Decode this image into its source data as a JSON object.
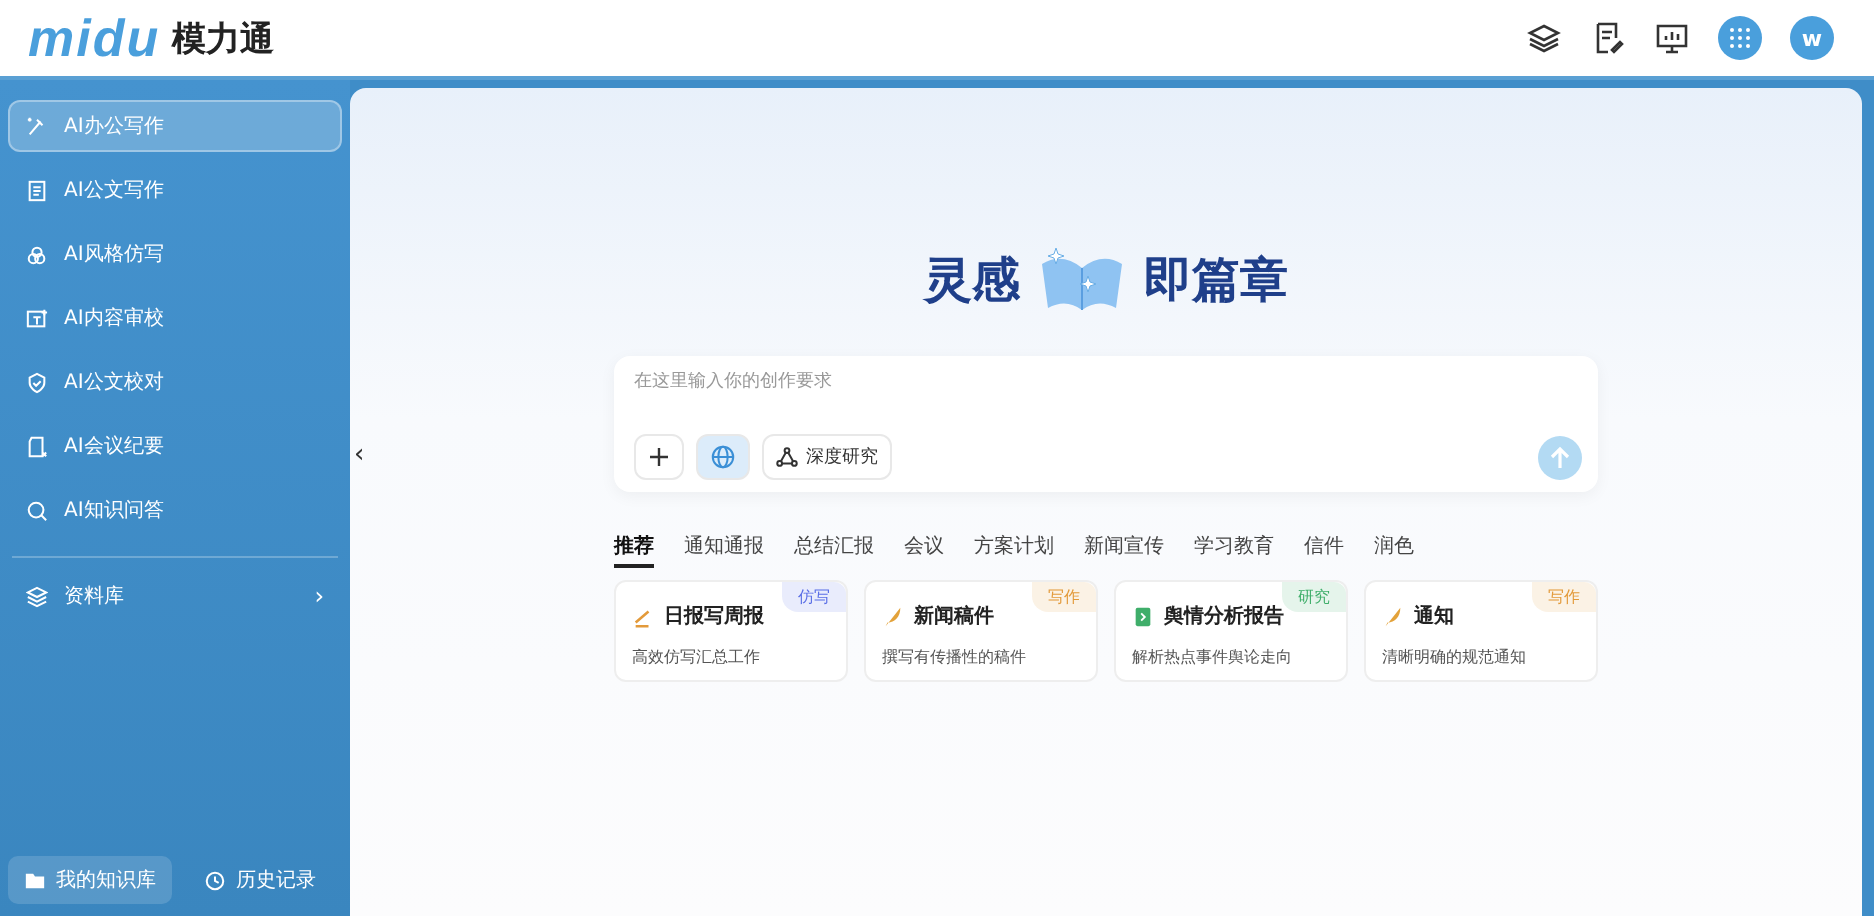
{
  "header": {
    "logo_mark": "midu",
    "logo_text": "模力通",
    "avatar": "w"
  },
  "sidebar": {
    "items": [
      {
        "label": "AI办公写作",
        "kind": "pen",
        "selected": true
      },
      {
        "label": "AI公文写作",
        "kind": "doc",
        "selected": false
      },
      {
        "label": "AI风格仿写",
        "kind": "style",
        "selected": false
      },
      {
        "label": "AI内容审校",
        "kind": "review",
        "selected": false
      },
      {
        "label": "AI公文校对",
        "kind": "shield",
        "selected": false
      },
      {
        "label": "AI会议纪要",
        "kind": "note",
        "selected": false
      },
      {
        "label": "AI知识问答",
        "kind": "search",
        "selected": false
      }
    ],
    "library": {
      "label": "资料库",
      "chevron": "›"
    },
    "bottom": [
      {
        "label": "我的知识库",
        "kind": "folder",
        "selected": true
      },
      {
        "label": "历史记录",
        "kind": "clock",
        "selected": false
      }
    ]
  },
  "collapse_handle": "‹",
  "hero": {
    "left": "灵感",
    "right": "即篇章"
  },
  "composer": {
    "placeholder": "在这里输入你的创作要求",
    "web_search": {
      "on": true
    },
    "deep_research": "深度研究"
  },
  "tabs": [
    {
      "label": "推荐",
      "selected": true
    },
    {
      "label": "通知通报",
      "selected": false
    },
    {
      "label": "总结汇报",
      "selected": false
    },
    {
      "label": "会议",
      "selected": false
    },
    {
      "label": "方案计划",
      "selected": false
    },
    {
      "label": "新闻宣传",
      "selected": false
    },
    {
      "label": "学习教育",
      "selected": false
    },
    {
      "label": "信件",
      "selected": false
    },
    {
      "label": "润色",
      "selected": false
    }
  ],
  "cards": [
    {
      "title": "日报写周报",
      "desc": "高效仿写汇总工作",
      "tag": "仿写",
      "color": "#5b6fe6",
      "kind": "pen"
    },
    {
      "title": "新闻稿件",
      "desc": "撰写有传播性的稿件",
      "tag": "写作",
      "color": "#e39a3a",
      "kind": "quill"
    },
    {
      "title": "舆情分析报告",
      "desc": "解析热点事件舆论走向",
      "tag": "研究",
      "color": "#3fae6a",
      "kind": "doc"
    },
    {
      "title": "通知",
      "desc": "清晰明确的规范通知",
      "tag": "写作",
      "color": "#e39a3a",
      "kind": "quill"
    }
  ]
}
